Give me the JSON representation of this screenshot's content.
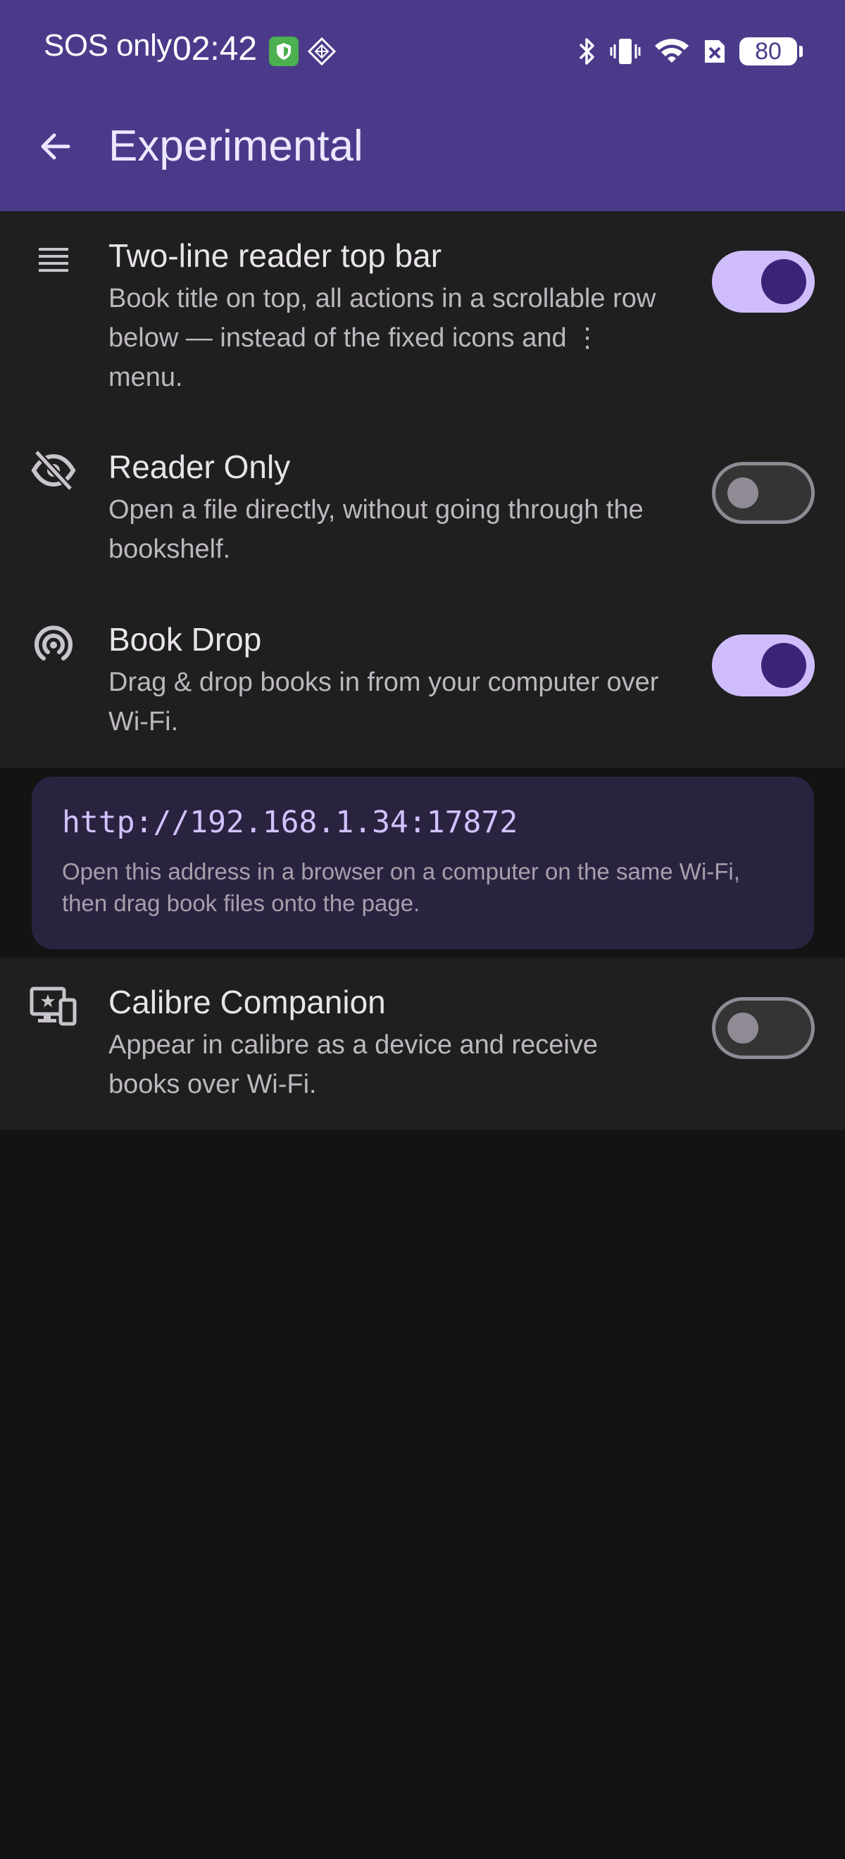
{
  "status_bar": {
    "carrier": "SOS only",
    "time": "02:42",
    "battery": "80",
    "icons": [
      "shield-icon",
      "grid-icon",
      "bluetooth-icon",
      "vibrate-icon",
      "wifi-icon",
      "no-sim-icon",
      "battery-icon"
    ]
  },
  "header": {
    "title": "Experimental",
    "back_icon": "arrow-left-icon"
  },
  "settings": [
    {
      "icon": "reader-topbar-icon",
      "title": "Two-line reader top bar",
      "description": "Book title on top, all actions in a scrollable row below — instead of the fixed icons and ⋮ menu.",
      "enabled": true
    },
    {
      "icon": "eye-off-icon",
      "title": "Reader Only",
      "description": "Open a file directly, without going through the bookshelf.",
      "enabled": false
    },
    {
      "icon": "broadcast-icon",
      "title": "Book Drop",
      "description": "Drag & drop books in from your computer over Wi-Fi.",
      "enabled": true
    },
    {
      "icon": "devices-icon",
      "title": "Calibre Companion",
      "description": "Appear in calibre as a device and receive books over Wi-Fi.",
      "enabled": false
    }
  ],
  "book_drop_card": {
    "url": "http://192.168.1.34:17872",
    "hint": "Open this address in a browser on a computer on the same Wi-Fi, then drag book files onto the page."
  },
  "colors": {
    "app_bar": "#4b3a8a",
    "surface": "#1f1f1f",
    "background": "#131313",
    "switch_on_track": "#cfbdfb",
    "switch_on_thumb": "#3b2478",
    "url_card": "#2a2340",
    "url_text": "#d2c2ff"
  }
}
